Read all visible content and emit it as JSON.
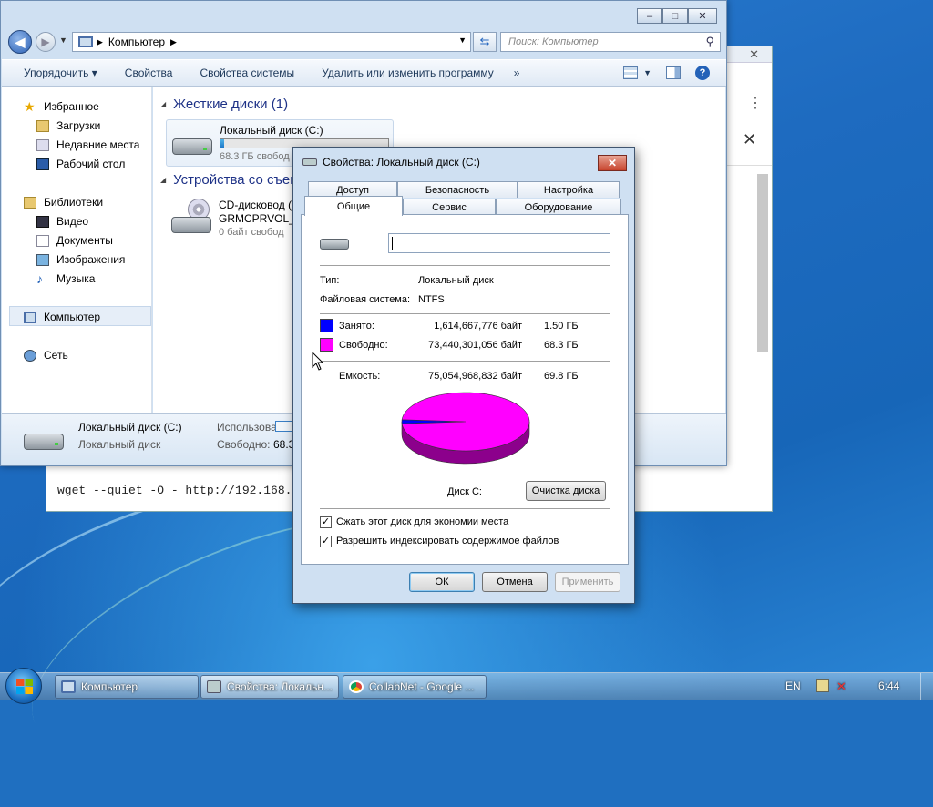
{
  "explorer": {
    "address": "Компьютер",
    "search_placeholder": "Поиск: Компьютер",
    "window_buttons": {
      "min": "–",
      "max": "□",
      "close": "✕"
    },
    "toolbar": {
      "organize": "Упорядочить",
      "properties": "Свойства",
      "system_properties": "Свойства системы",
      "uninstall": "Удалить или изменить программу",
      "more": "»"
    },
    "sidebar": {
      "favorites": "Избранное",
      "downloads": "Загрузки",
      "recent": "Недавние места",
      "desktop": "Рабочий стол",
      "libraries": "Библиотеки",
      "video": "Видео",
      "documents": "Документы",
      "images": "Изображения",
      "music": "Музыка",
      "computer": "Компьютер",
      "network": "Сеть"
    },
    "groups": {
      "hard_disks": "Жесткие диски (1)",
      "removable": "Устройства со съем"
    },
    "drive_c": {
      "name": "Локальный диск (C:)",
      "free": "68.3 ГБ свобод",
      "used_fraction": 0.02
    },
    "cd": {
      "line1": "CD-дисковод (D",
      "line2": "GRMCPRVOL_R",
      "line3": "0 байт свобод"
    },
    "details": {
      "name": "Локальный диск (C:)",
      "type": "Локальный диск",
      "used_label": "Использовано:",
      "free_label": "Свободно:",
      "free_value": "68.3"
    }
  },
  "background_window": {
    "command": "wget --quiet -O - http://192.168.1.1"
  },
  "dialog": {
    "title": "Свойства: Локальный диск (C:)",
    "close": "✕",
    "tabs_top": [
      "Доступ",
      "Безопасность",
      "Настройка"
    ],
    "tabs_bottom": [
      "Общие",
      "Сервис",
      "Оборудование"
    ],
    "volume_label": "",
    "type_label": "Тип:",
    "type_value": "Локальный диск",
    "fs_label": "Файловая система:",
    "fs_value": "NTFS",
    "used": {
      "label": "Занято:",
      "bytes": "1,614,667,776 байт",
      "size": "1.50 ГБ",
      "color": "#0000ff"
    },
    "free": {
      "label": "Свободно:",
      "bytes": "73,440,301,056 байт",
      "size": "68.3 ГБ",
      "color": "#ff00ff"
    },
    "capacity": {
      "label": "Емкость:",
      "bytes": "75,054,968,832 байт",
      "size": "69.8 ГБ"
    },
    "disk_label": "Диск C:",
    "cleanup_button": "Очистка диска",
    "compress_checkbox": "Сжать этот диск для экономии места",
    "index_checkbox": "Разрешить индексировать содержимое файлов",
    "compress_checked": true,
    "index_checked": true,
    "ok": "ОК",
    "cancel": "Отмена",
    "apply": "Применить"
  },
  "taskbar": {
    "items": [
      "Компьютер",
      "Свойства: Локальн...",
      "CollabNet - Google ..."
    ],
    "lang": "EN",
    "time": "6:44"
  },
  "chart_data": {
    "type": "pie",
    "categories": [
      "Занято",
      "Свободно"
    ],
    "values": [
      1614667776,
      73440301056
    ],
    "colors": [
      "#0000ff",
      "#ff00ff"
    ]
  }
}
